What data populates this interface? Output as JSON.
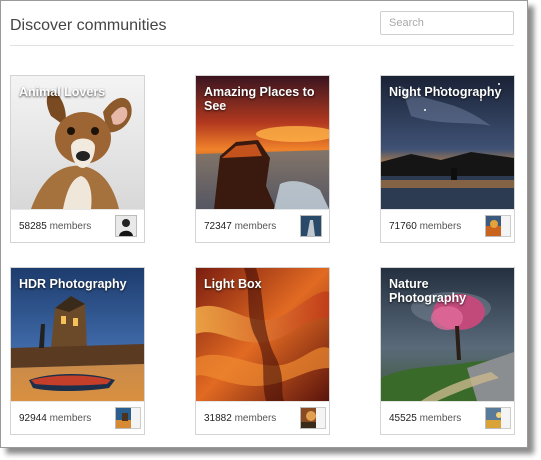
{
  "header": {
    "title": "Discover communities",
    "search_placeholder": "Search"
  },
  "members_label": "members",
  "communities": [
    {
      "name": "Animal Lovers",
      "count": "58285",
      "image_icon": "dog-photo-icon"
    },
    {
      "name": "Amazing Places to See",
      "count": "72347",
      "image_icon": "coast-sunset-photo-icon"
    },
    {
      "name": "Night Photography",
      "count": "71760",
      "image_icon": "night-sky-photo-icon"
    },
    {
      "name": "HDR Photography",
      "count": "92944",
      "image_icon": "harbor-dusk-photo-icon"
    },
    {
      "name": "Light Box",
      "count": "31882",
      "image_icon": "canyon-light-photo-icon"
    },
    {
      "name": "Nature Photography",
      "count": "45525",
      "image_icon": "stormy-tree-photo-icon"
    }
  ]
}
